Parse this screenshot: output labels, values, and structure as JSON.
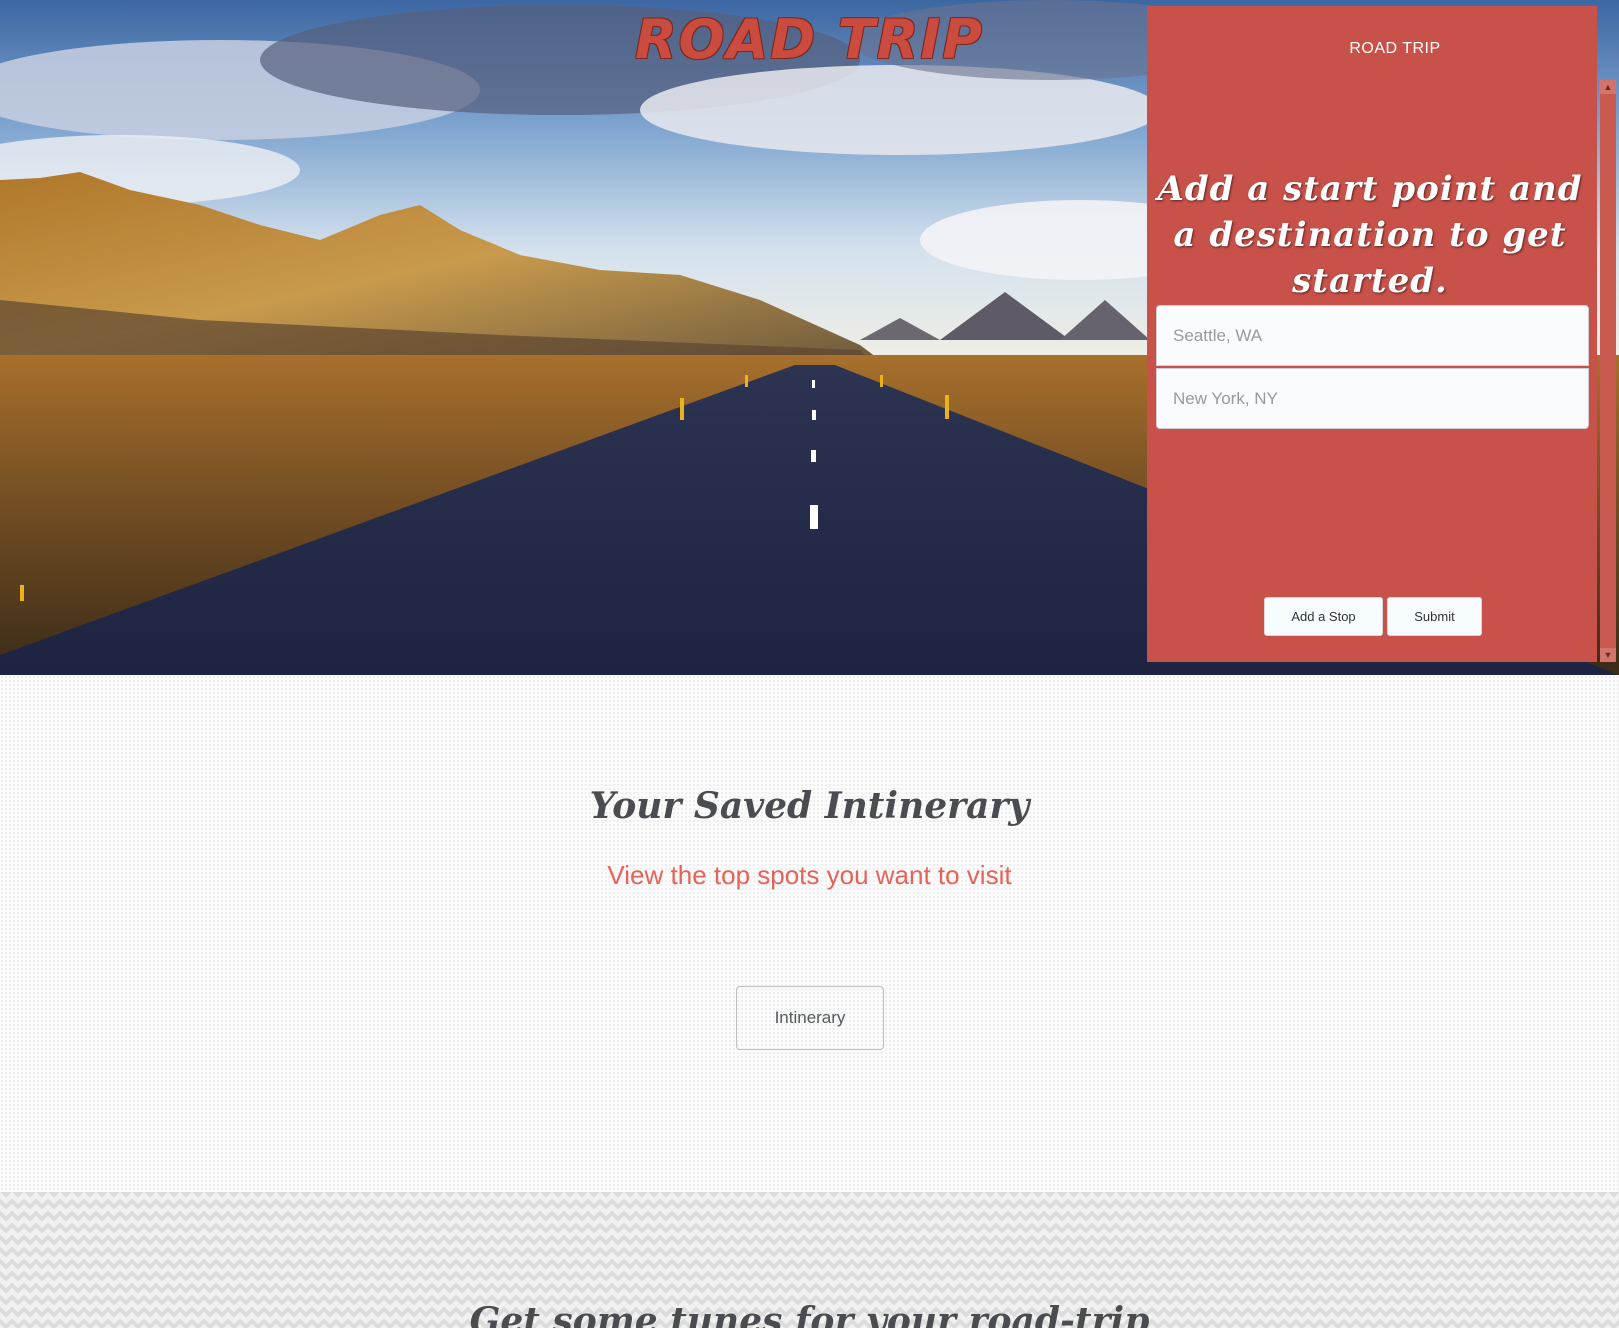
{
  "hero": {
    "title": "ROAD TRIP"
  },
  "panel": {
    "brand": "ROAD TRIP",
    "heading": "Add a start point and a destination to get started.",
    "start_placeholder": "Seattle, WA",
    "destination_placeholder": "New York, NY",
    "add_stop_label": "Add a Stop",
    "submit_label": "Submit"
  },
  "itinerary": {
    "title": "Your Saved Intinerary",
    "subtitle": "View the top spots you want to visit",
    "button_label": "Intinerary"
  },
  "tunes": {
    "title": "Get some tunes for your road-trip"
  },
  "colors": {
    "panel_bg": "#c85149",
    "accent_text": "#e5645a",
    "heading_text": "#4a4c52"
  },
  "icons": {
    "scroll_up": "triangle-up",
    "scroll_down": "triangle-down"
  }
}
